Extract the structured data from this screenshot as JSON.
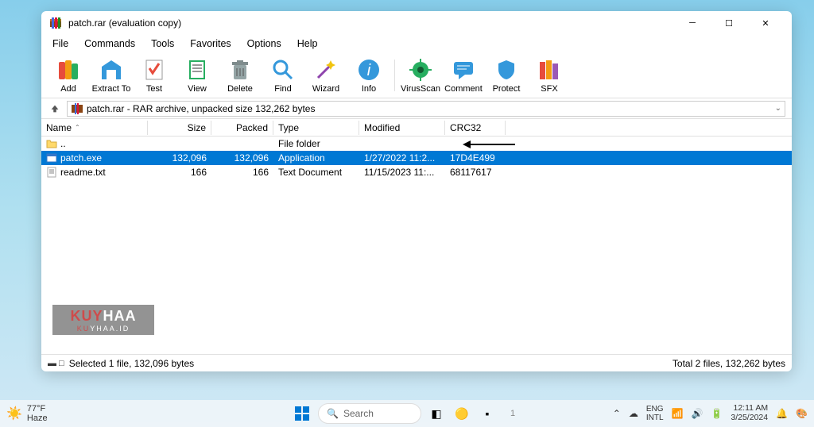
{
  "window": {
    "title": "patch.rar (evaluation copy)"
  },
  "menu": [
    "File",
    "Commands",
    "Tools",
    "Favorites",
    "Options",
    "Help"
  ],
  "toolbar": [
    {
      "label": "Add"
    },
    {
      "label": "Extract To"
    },
    {
      "label": "Test"
    },
    {
      "label": "View"
    },
    {
      "label": "Delete"
    },
    {
      "label": "Find"
    },
    {
      "label": "Wizard"
    },
    {
      "label": "Info"
    },
    {
      "label": "VirusScan"
    },
    {
      "label": "Comment"
    },
    {
      "label": "Protect"
    },
    {
      "label": "SFX"
    }
  ],
  "address": "patch.rar - RAR archive, unpacked size 132,262 bytes",
  "columns": {
    "name": "Name",
    "size": "Size",
    "packed": "Packed",
    "type": "Type",
    "modified": "Modified",
    "crc": "CRC32"
  },
  "rows": [
    {
      "name": "..",
      "size": "",
      "packed": "",
      "type": "File folder",
      "modified": "",
      "crc": "",
      "icon": "folder",
      "selected": false
    },
    {
      "name": "patch.exe",
      "size": "132,096",
      "packed": "132,096",
      "type": "Application",
      "modified": "1/27/2022 11:2...",
      "crc": "17D4E499",
      "icon": "exe",
      "selected": true
    },
    {
      "name": "readme.txt",
      "size": "166",
      "packed": "166",
      "type": "Text Document",
      "modified": "11/15/2023 11:...",
      "crc": "68117617",
      "icon": "txt",
      "selected": false
    }
  ],
  "status": {
    "left": "Selected 1 file, 132,096 bytes",
    "right": "Total 2 files, 132,262 bytes"
  },
  "watermark": {
    "line1a": "KUY",
    "line1b": "HAA",
    "line2a": "KU",
    "line2b": "YHAA.ID"
  },
  "taskbar": {
    "weather": {
      "temp": "77°F",
      "cond": "Haze"
    },
    "search": "Search",
    "tray": {
      "lang1": "ENG",
      "lang2": "INTL",
      "time": "12:11 AM",
      "date": "3/25/2024"
    }
  }
}
